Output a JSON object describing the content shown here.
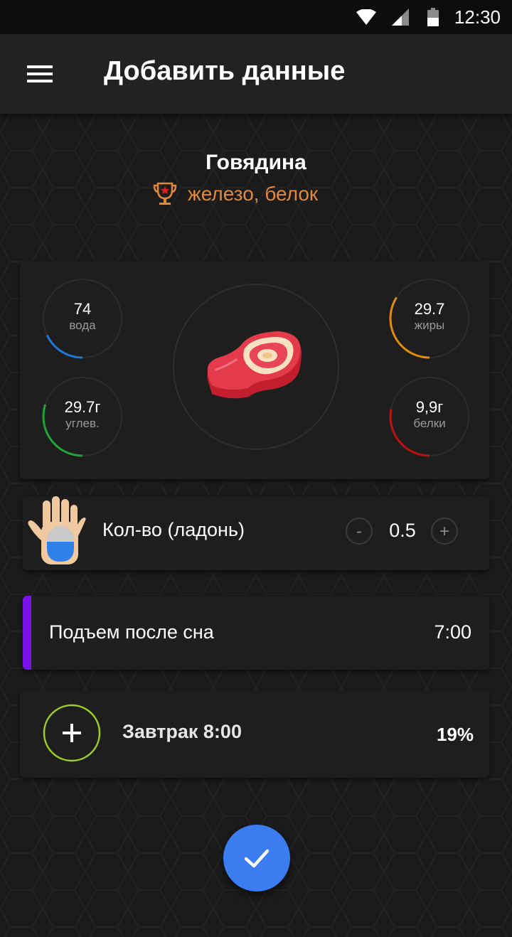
{
  "status_bar": {
    "time": "12:30",
    "icons": [
      "wifi-icon",
      "signal-icon",
      "battery-icon"
    ]
  },
  "app_bar": {
    "menu_icon": "hamburger-menu-icon",
    "title": "Добавить данные"
  },
  "food": {
    "name": "Говядина",
    "tags_icon": "trophy-icon",
    "tags": "железо, белок",
    "image_icon": "steak-icon"
  },
  "nutrients": [
    {
      "key": "water",
      "value": "74",
      "label": "вода",
      "color": "#1e7ad6",
      "progress": 0.18
    },
    {
      "key": "carbs",
      "value": "29.7г",
      "label": "углев.",
      "color": "#1fa33a",
      "progress": 0.3
    },
    {
      "key": "fat",
      "value": "29.7",
      "label": "жиры",
      "color": "#e08d0c",
      "progress": 0.34
    },
    {
      "key": "protein",
      "value": "9,9г",
      "label": "белки",
      "color": "#bb1313",
      "progress": 0.28
    }
  ],
  "quantity": {
    "label": "Кол-во (ладонь)",
    "value": "0.5",
    "minus": "-",
    "plus": "+",
    "icon": "palm-hand-icon"
  },
  "event": {
    "label": "Подъем после сна",
    "time": "7:00",
    "accent_color": "#7b12ea"
  },
  "meal": {
    "label": "Завтрак 8:00",
    "percent": "19%",
    "ring_color": "#9ccc25"
  },
  "fab": {
    "icon": "check-icon",
    "color": "#3b7cf0"
  },
  "colors": {
    "background": "#1b1b1b",
    "card": "#1e1e1e",
    "appbar": "#222222",
    "tag_text": "#e0883c"
  }
}
